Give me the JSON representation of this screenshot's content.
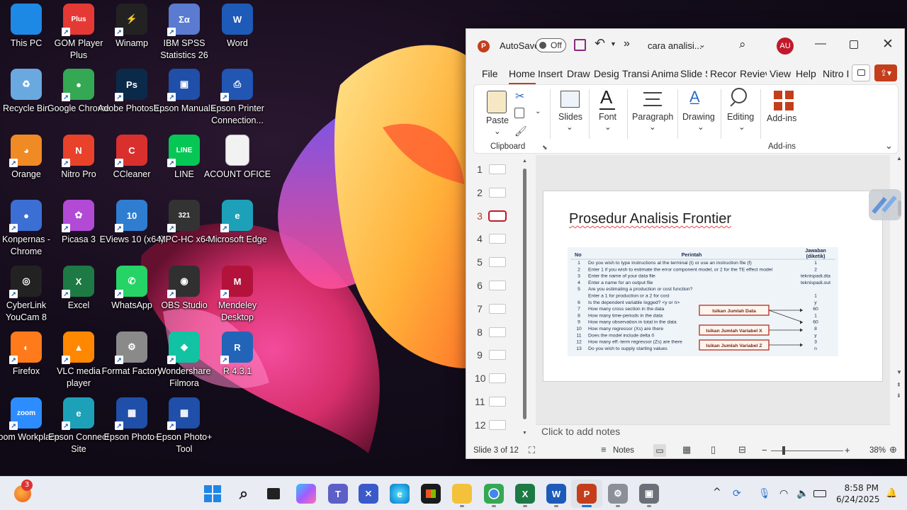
{
  "desktop": {
    "icons": [
      {
        "label": "This PC",
        "icon": "monitor-icon",
        "color": "#1e88e5"
      },
      {
        "label": "GOM Player Plus",
        "icon": "gom-player-icon",
        "color": "#e53935",
        "glyph": "Plus"
      },
      {
        "label": "Winamp",
        "icon": "winamp-icon",
        "color": "#222222",
        "glyph": "⚡"
      },
      {
        "label": "IBM SPSS Statistics 26",
        "icon": "spss-icon",
        "color": "#5a7bd0",
        "glyph": "Σα"
      },
      {
        "label": "Word",
        "icon": "word-icon",
        "color": "#1e5ab8",
        "glyph": "W"
      },
      {
        "label": "Recycle Bin",
        "icon": "recycle-bin-icon",
        "color": "#6aa8e0",
        "glyph": "♻"
      },
      {
        "label": "Google Chrome",
        "icon": "chrome-icon",
        "color": "#34a853",
        "glyph": "●"
      },
      {
        "label": "Adobe Photosh...",
        "icon": "photoshop-icon",
        "color": "#0b2a4a",
        "glyph": "Ps"
      },
      {
        "label": "Epson Manuals",
        "icon": "epson-manuals-icon",
        "color": "#1f4fa8",
        "glyph": "▣"
      },
      {
        "label": "Epson Printer Connection...",
        "icon": "epson-printer-icon",
        "color": "#2156b3",
        "glyph": "⎙"
      },
      {
        "label": "Orange",
        "icon": "orange-icon",
        "color": "#f08a24",
        "glyph": "◕"
      },
      {
        "label": "Nitro Pro",
        "icon": "nitro-pro-icon",
        "color": "#e8422b",
        "glyph": "N"
      },
      {
        "label": "CCleaner",
        "icon": "ccleaner-icon",
        "color": "#d9302e",
        "glyph": "C"
      },
      {
        "label": "LINE",
        "icon": "line-icon",
        "color": "#06c755",
        "glyph": "LINE"
      },
      {
        "label": "ACOUNT OFICE",
        "icon": "document-icon",
        "color": "#f2f2f2",
        "glyph": ""
      },
      {
        "label": "Konpernas - Chrome",
        "icon": "chrome-app-icon",
        "color": "#3b6fd4",
        "glyph": "●"
      },
      {
        "label": "Picasa 3",
        "icon": "picasa-icon",
        "color": "#b24ad6",
        "glyph": "✿"
      },
      {
        "label": "EViews 10 (x64)",
        "icon": "eviews-icon",
        "color": "#2f7dd1",
        "glyph": "10"
      },
      {
        "label": "MPC-HC x64",
        "icon": "mpc-hc-icon",
        "color": "#333333",
        "glyph": "321"
      },
      {
        "label": "Microsoft Edge",
        "icon": "edge-icon",
        "color": "#1da1b8",
        "glyph": "e"
      },
      {
        "label": "CyberLink YouCam 8",
        "icon": "youcam-icon",
        "color": "#222222",
        "glyph": "◎"
      },
      {
        "label": "Excel",
        "icon": "excel-icon",
        "color": "#1d7a45",
        "glyph": "X"
      },
      {
        "label": "WhatsApp",
        "icon": "whatsapp-icon",
        "color": "#25d366",
        "glyph": "✆"
      },
      {
        "label": "OBS Studio",
        "icon": "obs-icon",
        "color": "#303030",
        "glyph": "◉"
      },
      {
        "label": "Mendeley Desktop",
        "icon": "mendeley-icon",
        "color": "#b3123b",
        "glyph": "M"
      },
      {
        "label": "Firefox",
        "icon": "firefox-icon",
        "color": "#ff7a1a",
        "glyph": "◐"
      },
      {
        "label": "VLC media player",
        "icon": "vlc-icon",
        "color": "#ff8800",
        "glyph": "▲"
      },
      {
        "label": "Format Factory",
        "icon": "format-factory-icon",
        "color": "#8a8a8a",
        "glyph": "⚙"
      },
      {
        "label": "Wondershare Filmora",
        "icon": "filmora-icon",
        "color": "#11c3a3",
        "glyph": "◆"
      },
      {
        "label": "R 4.3.1",
        "icon": "r-icon",
        "color": "#2265b8",
        "glyph": "R"
      },
      {
        "label": "Zoom Workplace",
        "icon": "zoom-icon",
        "color": "#2d8cff",
        "glyph": "zoom"
      },
      {
        "label": "Epson Connect Site",
        "icon": "epson-connect-icon",
        "color": "#1da1b8",
        "glyph": "e"
      },
      {
        "label": "Epson Photo+",
        "icon": "epson-photo-icon",
        "color": "#1f4fa8",
        "glyph": "▦"
      },
      {
        "label": "Epson Photo+ Tool",
        "icon": "epson-photo-tool-icon",
        "color": "#1f4fa8",
        "glyph": "▦"
      }
    ]
  },
  "ppt": {
    "autosave_label": "AutoSave",
    "autosave_state": "Off",
    "more_label": "»",
    "doc_title": "cara analisi...",
    "avatar": "AU",
    "tabs": [
      "File",
      "Home",
      "Insert",
      "Draw",
      "Desig",
      "Transit",
      "Anima",
      "Slide S",
      "Recor",
      "Reviev",
      "View",
      "Help",
      "Nitro I"
    ],
    "ribbon": {
      "paste": "Paste",
      "clipboard": "Clipboard",
      "slides": "Slides",
      "font": "Font",
      "paragraph": "Paragraph",
      "drawing": "Drawing",
      "editing": "Editing",
      "addins": "Add-ins",
      "addins_group": "Add-ins"
    },
    "thumbnails": [
      "1",
      "2",
      "3",
      "4",
      "5",
      "6",
      "7",
      "8",
      "9",
      "10",
      "11",
      "12"
    ],
    "active_slide": 3,
    "slide": {
      "title": "Prosedur Analisis Frontier",
      "table": {
        "headers": [
          "No",
          "Perintah",
          "Jawaban (diketik)"
        ],
        "rows": [
          [
            "1",
            "Do you wish to type instructions at the terminal (t) or use an instruction file (f)",
            "1"
          ],
          [
            "2",
            "Enter 1 if you wish to estimate the error component model, or 2 for the TE effect model",
            "2"
          ],
          [
            "3",
            "Enter the name of your data file",
            "teknispadi.dta"
          ],
          [
            "4",
            "Enter a name for an output file",
            "teknispadi.out"
          ],
          [
            "5",
            "Are you estimating a production or cost function?",
            ""
          ],
          [
            "",
            "Enter a 1 for production or a 2 for cost",
            "1"
          ],
          [
            "6",
            "Is the dependent variable logged? <y or n>",
            "y"
          ],
          [
            "7",
            "How many cross section in the data",
            "60"
          ],
          [
            "8",
            "How many time-periods in the data",
            "1"
          ],
          [
            "9",
            "How many observation in total in the data",
            "60"
          ],
          [
            "10",
            "How many regressor (Xs) are there",
            "8"
          ],
          [
            "11",
            "Does the model include delta 0",
            "y"
          ],
          [
            "12",
            "How many eff.-term regressor (Zs) are there",
            "3"
          ],
          [
            "13",
            "Do you wish to supply starting values",
            "n"
          ]
        ],
        "callouts": [
          "Isikan Jumlah Data",
          "Isikan Jumlah Variabel X",
          "Isikan Jumlah Variabel Z"
        ]
      }
    },
    "notes_placeholder": "Click to add notes",
    "status": {
      "slide_of": "Slide 3 of 12",
      "notes": "Notes",
      "zoom": "38%",
      "minus": "−",
      "plus": "+"
    }
  },
  "taskbar": {
    "weather_badge": "3",
    "time": "8:58 PM",
    "date": "6/24/2025",
    "tray_chevron": "^"
  }
}
